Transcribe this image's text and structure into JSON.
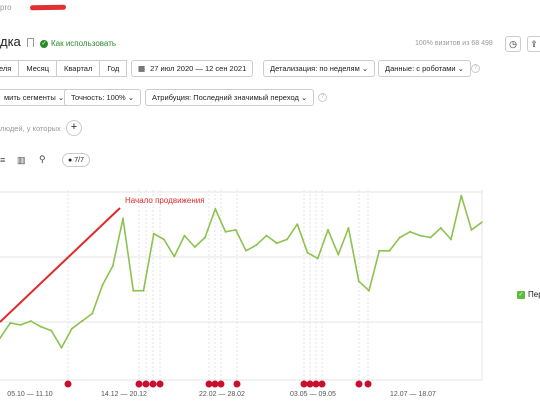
{
  "url_prefix": "pro",
  "page_title": "дка",
  "how_to_use": "Как использовать",
  "visits_info": "100% визитов из 68 498",
  "periods": [
    "еля",
    "Месяц",
    "Квартал",
    "Год"
  ],
  "date_range": "27 июл 2020 — 12 сен 2021",
  "detail": "Детализация: по неделям",
  "data_robots": "Данные: с роботами",
  "segments": "мить сегменты",
  "accuracy": "Точность: 100%",
  "attribution": "Атрибуция: Последний значимый переход",
  "people_text": "людей, у которых",
  "series_count": "7/7",
  "legend_label": "Пер",
  "annotation": "Начало продвижения",
  "colors": {
    "line": "#8cc34f",
    "annotation": "#e02a2a",
    "marker": "#c8102e",
    "accent": "#2a8a2a"
  },
  "chart_data": {
    "type": "line",
    "x_ticks": [
      "05.10 — 11.10",
      "14.12 — 20.12",
      "22.02 — 28.02",
      "03.05 — 09.05",
      "12.07 — 18.07"
    ],
    "series": [
      {
        "name": "Пер",
        "values": [
          22,
          30,
          29,
          31,
          28,
          26,
          17,
          27,
          31,
          35,
          50,
          60,
          85,
          47,
          47,
          77,
          74,
          65,
          76,
          70,
          75,
          90,
          78,
          79,
          68,
          71,
          76,
          72,
          74,
          82,
          67,
          64,
          79,
          66,
          80,
          52,
          47,
          68,
          68,
          75,
          78,
          76,
          75,
          80,
          74,
          97,
          79,
          83
        ]
      }
    ],
    "annotation_label": "Начало продвижения"
  }
}
